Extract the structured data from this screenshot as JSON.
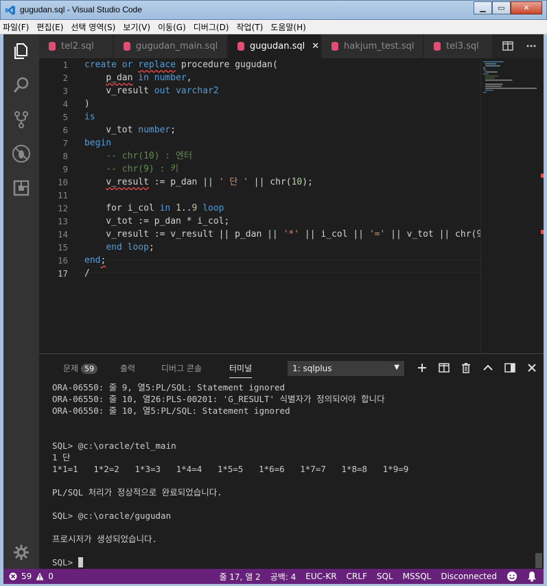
{
  "window": {
    "title": "gugudan.sql - Visual Studio Code"
  },
  "menu": [
    "파일(F)",
    "편집(E)",
    "선택 영역(S)",
    "보기(V)",
    "이동(G)",
    "디버그(D)",
    "작업(T)",
    "도움말(H)"
  ],
  "tabs": [
    {
      "label": "tel2.sql"
    },
    {
      "label": "gugudan_main.sql"
    },
    {
      "label": "gugudan.sql",
      "active": true
    },
    {
      "label": "hakjum_test.sql"
    },
    {
      "label": "tel3.sql"
    }
  ],
  "editor": {
    "line_numbers": [
      "1",
      "2",
      "3",
      "4",
      "5",
      "6",
      "7",
      "8",
      "9",
      "10",
      "11",
      "12",
      "13",
      "14",
      "15",
      "16",
      "17"
    ],
    "current_line": 17
  },
  "panel": {
    "tabs": {
      "problems": "문제",
      "problems_count": "59",
      "output": "출력",
      "debug_console": "디버그 콘솔",
      "terminal": "터미널"
    },
    "terminal_select": "1: sqlplus",
    "terminal_lines": [
      "ORA-06550: 줄 9, 열5:PL/SQL: Statement ignored",
      "ORA-06550: 줄 10, 열26:PLS-00201: 'G_RESULT' 식별자가 정의되어야 합니다",
      "ORA-06550: 줄 10, 열5:PL/SQL: Statement ignored",
      "",
      "",
      "SQL> @c:\\oracle/tel_main",
      "1 단",
      "1*1=1   1*2=2   1*3=3   1*4=4   1*5=5   1*6=6   1*7=7   1*8=8   1*9=9",
      "",
      "PL/SQL 처리가 정상적으로 완료되었습니다.",
      "",
      "SQL> @c:\\oracle/gugudan",
      "",
      "프로시저가 생성되었습니다.",
      "",
      "SQL> "
    ]
  },
  "status": {
    "errors": "59",
    "warnings": "0",
    "position": "줄 17, 열 2",
    "spaces": "공백: 4",
    "encoding": "EUC-KR",
    "eol": "CRLF",
    "language": "SQL",
    "dialect": "MSSQL",
    "connection": "Disconnected"
  },
  "colors": {
    "statusbar": "#68217a",
    "editor_bg": "#1e1e1e",
    "keyword": "#569cd6",
    "comment": "#608b4e",
    "string": "#ce9178"
  }
}
